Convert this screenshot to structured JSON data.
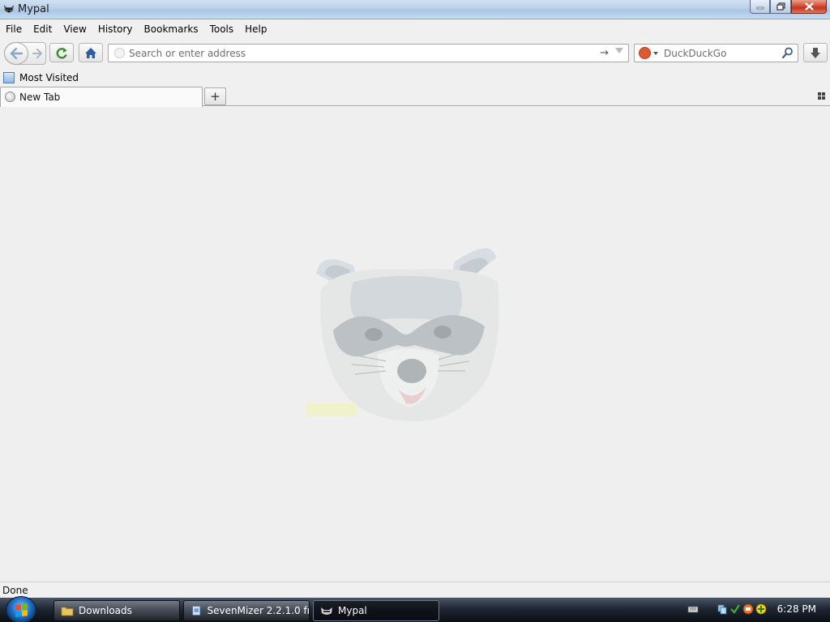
{
  "window": {
    "title": "Mypal"
  },
  "menu": {
    "items": [
      "File",
      "Edit",
      "View",
      "History",
      "Bookmarks",
      "Tools",
      "Help"
    ]
  },
  "navbar": {
    "url_placeholder": "Search or enter address",
    "search_placeholder": "DuckDuckGo"
  },
  "bookmarks": {
    "items": [
      {
        "label": "Most Visited"
      }
    ]
  },
  "tabs": {
    "items": [
      {
        "label": "New Tab"
      }
    ],
    "new_tab_symbol": "+"
  },
  "status": {
    "text": "Done"
  },
  "taskbar": {
    "tasks": [
      {
        "label": "Downloads",
        "icon": "folder-icon"
      },
      {
        "label": "SevenMizer 2.2.1.0 fr...",
        "icon": "installer-icon"
      },
      {
        "label": "Mypal",
        "icon": "mypal-icon",
        "active": true
      }
    ],
    "clock": "6:28 PM"
  },
  "colors": {
    "titlebar": "#b9d1ea",
    "chrome": "#f0f0f0",
    "content_bg": "#efefef",
    "home_blue": "#2a5fa8",
    "reload_green": "#3a8a2e",
    "search_engine": "#de5833"
  }
}
